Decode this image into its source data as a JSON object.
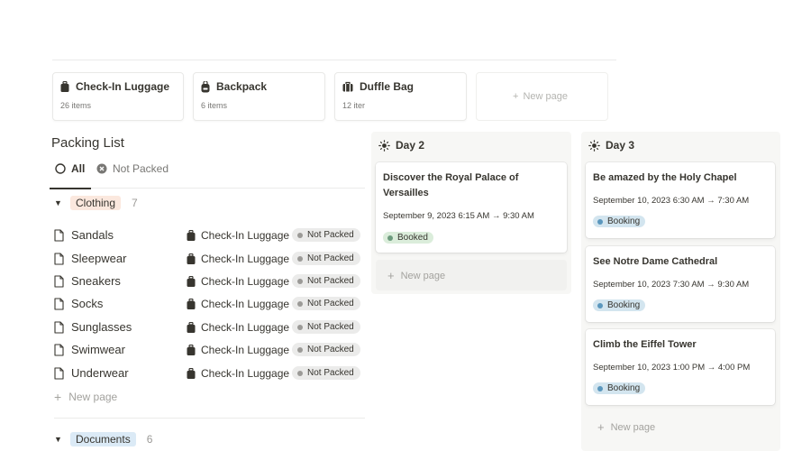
{
  "gallery": {
    "cards": [
      {
        "title": "Check-In Luggage",
        "sub": "26 items",
        "icon": "suitcase-icon"
      },
      {
        "title": "Backpack",
        "sub": "6 items",
        "icon": "backpack-icon"
      },
      {
        "title": "Duffle Bag",
        "sub": "12 iter",
        "icon": "duffle-bag-icon"
      }
    ],
    "new_page": "New page"
  },
  "packing": {
    "title": "Packing List",
    "tabs": [
      {
        "label": "All",
        "icon": "circle-icon"
      },
      {
        "label": "Not Packed",
        "icon": "x-circle-icon"
      }
    ],
    "groups": [
      {
        "label": "Clothing",
        "count": "7",
        "color": "#fbe8de"
      },
      {
        "label": "Documents",
        "count": "6",
        "color": "#dbeaf6"
      }
    ],
    "rows": [
      {
        "name": "Sandals",
        "luggage": "Check-In Luggage",
        "status": "Not Packed"
      },
      {
        "name": "Sleepwear",
        "luggage": "Check-In Luggage",
        "status": "Not Packed"
      },
      {
        "name": "Sneakers",
        "luggage": "Check-In Luggage",
        "status": "Not Packed"
      },
      {
        "name": "Socks",
        "luggage": "Check-In Luggage",
        "status": "Not Packed"
      },
      {
        "name": "Sunglasses",
        "luggage": "Check-In Luggage",
        "status": "Not Packed"
      },
      {
        "name": "Swimwear",
        "luggage": "Check-In Luggage",
        "status": "Not Packed"
      },
      {
        "name": "Underwear",
        "luggage": "Check-In Luggage",
        "status": "Not Packed"
      }
    ],
    "new_page": "New page"
  },
  "board": {
    "columns": [
      {
        "title": "Day 2",
        "cards": [
          {
            "title": "Discover the Royal Palace of Versailles",
            "date": "September 9, 2023 6:15 AM → 9:30 AM",
            "status": "Booked"
          }
        ],
        "new_page": "New page"
      },
      {
        "title": "Day 3",
        "cards": [
          {
            "title": "Be amazed by the Holy Chapel",
            "date": "September 10, 2023 6:30 AM → 7:30 AM",
            "status": "Booking"
          },
          {
            "title": "See Notre Dame Cathedral",
            "date": "September 10, 2023 7:30 AM → 9:30 AM",
            "status": "Booking"
          },
          {
            "title": "Climb the Eiffel Tower",
            "date": "September 10, 2023 1:00 PM → 4:00 PM",
            "status": "Booking"
          }
        ],
        "new_page": "New page"
      }
    ]
  },
  "colors": {
    "booked_bg": "#dbeddb",
    "booked_dot": "#6c9b7d",
    "booking_bg": "#d3e5ef",
    "booking_dot": "#5b97bd",
    "not_packed_bg": "#ebebea",
    "not_packed_dot": "#9b9a97"
  }
}
